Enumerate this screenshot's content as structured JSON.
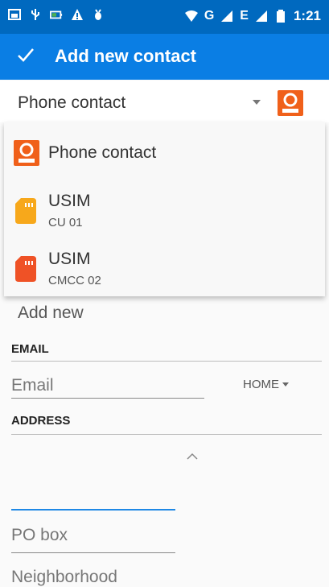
{
  "status_bar": {
    "time": "1:21",
    "network_label": "G",
    "network_label_2": "E",
    "icons": [
      "screenshot-icon",
      "usb-icon",
      "battery-saver-icon",
      "warning-icon",
      "debug-icon",
      "wifi-icon",
      "signal-icon",
      "battery-icon"
    ]
  },
  "app_bar": {
    "title": "Add new contact",
    "icon": "check-icon"
  },
  "account_selector": {
    "selected": "Phone contact"
  },
  "dropdown": {
    "items": [
      {
        "title": "Phone contact",
        "subtitle": "",
        "icon": "phone-contact-icon",
        "color": "#f0601a"
      },
      {
        "title": "USIM",
        "subtitle": "CU 01",
        "icon": "sim-card-icon",
        "color": "#f7a81b"
      },
      {
        "title": "USIM",
        "subtitle": "CMCC 02",
        "icon": "sim-card-icon",
        "color": "#ef5226"
      }
    ]
  },
  "form": {
    "add_new_label": "Add new",
    "email_section": "EMAIL",
    "email_placeholder": "Email",
    "email_type": "HOME",
    "address_section": "ADDRESS",
    "po_box_placeholder": "PO box",
    "neighborhood_placeholder": "Neighborhood"
  },
  "colors": {
    "status_bar": "#0069bf",
    "app_bar": "#0a7ee4",
    "accent": "#1e88e5"
  }
}
